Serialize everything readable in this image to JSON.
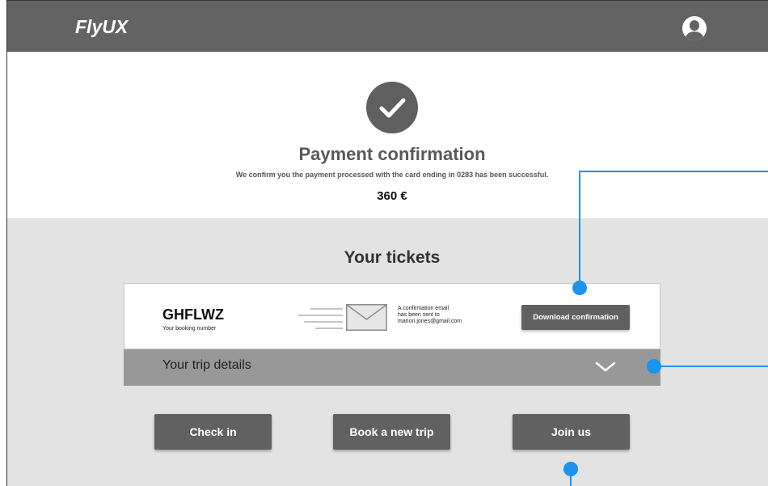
{
  "header": {
    "logo_text": "FlyUX",
    "avatar_icon": "user-avatar-icon"
  },
  "confirmation": {
    "icon": "checkmark-icon",
    "title": "Payment confirmation",
    "message": "We confirm you the payment processed with the card ending in 0283 has been successful.",
    "amount": "360 €"
  },
  "tickets": {
    "heading": "Your tickets",
    "booking_code": "GHFLWZ",
    "booking_label": "Your booking number",
    "email_icon": "envelope-icon",
    "email_note_line1": "A confirmation email",
    "email_note_line2": "has been sent to",
    "email_address": "marion.jones@gmail.com",
    "download_label": "Download confirmation"
  },
  "trip_details": {
    "label": "Your trip details",
    "toggle_icon": "chevron-down-icon"
  },
  "actions": {
    "check_in": "Check in",
    "book_new_trip": "Book a new trip",
    "join_us": "Join us"
  },
  "colors": {
    "header_bg": "#636363",
    "button_bg": "#616161",
    "lower_section_bg": "#e3e3e3",
    "trip_bar_bg": "#989898",
    "annotation_accent": "#1b94f0"
  }
}
